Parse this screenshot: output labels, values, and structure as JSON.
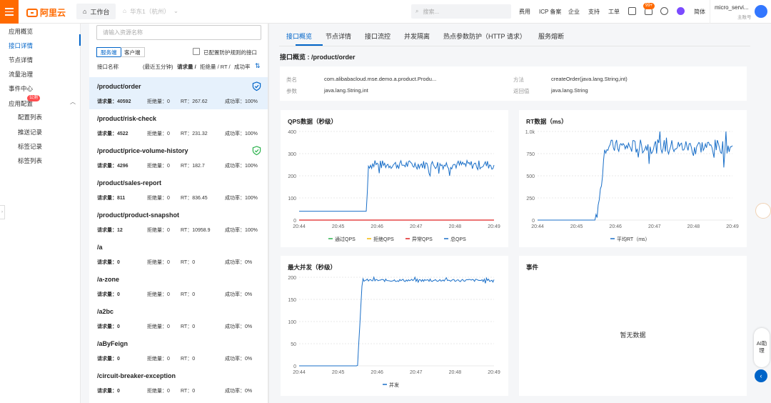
{
  "topbar": {
    "brand": "阿里云",
    "workbench": "工作台",
    "region": "华东1（杭州）",
    "search_placeholder": "搜索...",
    "nav": [
      "费用",
      "ICP 备案",
      "企业",
      "支持",
      "工单"
    ],
    "badge": "99+",
    "lang": "简体",
    "user": "micro_servi...",
    "user_sub": "主账号"
  },
  "sidebar": {
    "items": [
      "应用概览",
      "接口详情",
      "节点详情",
      "流量治理",
      "事件中心",
      "应用配置",
      "配置列表",
      "推送记录",
      "标签记录",
      "标签列表"
    ],
    "hot": "公测"
  },
  "list": {
    "search_placeholder": "请输入资源名称",
    "seg": [
      "服务端",
      "客户端"
    ],
    "checkbox_label": "已配置防护规则的接口",
    "headers": [
      "接口名称",
      "(最近五分钟)",
      "请求量 /",
      "拒绝量 / RT /",
      "成功率"
    ],
    "stat_labels": {
      "req": "请求量：",
      "rej": "拒绝量：",
      "rt": "RT：",
      "succ": "成功率："
    },
    "rows": [
      {
        "name": "/product/order",
        "req": "40592",
        "rej": "0",
        "rt": "267.62",
        "succ": "100%"
      },
      {
        "name": "/product/risk-check",
        "req": "4522",
        "rej": "0",
        "rt": "231.32",
        "succ": "100%"
      },
      {
        "name": "/product/price-volume-history",
        "req": "4296",
        "rej": "0",
        "rt": "182.7",
        "succ": "100%"
      },
      {
        "name": "/product/sales-report",
        "req": "811",
        "rej": "0",
        "rt": "836.45",
        "succ": "100%"
      },
      {
        "name": "/product/product-snapshot",
        "req": "12",
        "rej": "0",
        "rt": "10958.9",
        "succ": "100%"
      },
      {
        "name": "/a",
        "req": "0",
        "rej": "0",
        "rt": "0",
        "succ": "0%"
      },
      {
        "name": "/a-zone",
        "req": "0",
        "rej": "0",
        "rt": "0",
        "succ": "0%"
      },
      {
        "name": "/a2bc",
        "req": "0",
        "rej": "0",
        "rt": "0",
        "succ": "0%"
      },
      {
        "name": "/aByFeign",
        "req": "0",
        "rej": "0",
        "rt": "0",
        "succ": "0%"
      },
      {
        "name": "/circuit-breaker-exception",
        "req": "0",
        "rej": "0",
        "rt": "0",
        "succ": "0%"
      }
    ]
  },
  "tabs": [
    "接口概览",
    "节点详情",
    "接口流控",
    "并发隔离",
    "热点参数防护（HTTP 请求）",
    "服务熔断"
  ],
  "overview": {
    "title": "接口概览 : /product/order",
    "info": {
      "class_label": "类名",
      "class": "com.alibabacloud.mse.demo.a.product.Produ...",
      "method_label": "方法",
      "method": "createOrder(java.lang.String,int)",
      "params_label": "参数",
      "params": "java.lang.String,int",
      "return_label": "返回值",
      "return": "java.lang.String"
    }
  },
  "events": {
    "title": "事件",
    "empty": "暂无数据"
  },
  "assistant": {
    "label": "AI助理"
  },
  "colors": {
    "accent": "#0064c8",
    "brand": "#ff6a00",
    "series_blue": "#1a6fc8",
    "series_red": "#e02020",
    "series_green": "#2bb24c",
    "series_yellow": "#f5b800"
  },
  "chart_data": [
    {
      "type": "line",
      "title": "QPS数据（秒级）",
      "x_ticks": [
        "20:44",
        "20:45",
        "20:46",
        "20:47",
        "20:48",
        "20:49"
      ],
      "ylim": [
        0,
        400
      ],
      "y_ticks": [
        0,
        100,
        200,
        300,
        400
      ],
      "series": [
        {
          "name": "通过QPS",
          "color": "#2bb24c"
        },
        {
          "name": "拒绝QPS",
          "color": "#f5b800"
        },
        {
          "name": "异常QPS",
          "color": "#e02020"
        },
        {
          "name": "总QPS",
          "color": "#1a6fc8"
        }
      ],
      "approx_values": {
        "before_20:45:45": 40,
        "after_20:45:45": 250,
        "red_line": 0
      }
    },
    {
      "type": "line",
      "title": "RT数据（ms）",
      "x_ticks": [
        "20:44",
        "20:45",
        "20:46",
        "20:47",
        "20:48",
        "20:49"
      ],
      "ylim": [
        0,
        1000
      ],
      "y_ticks": [
        "0",
        "250",
        "500",
        "750",
        "1.0k"
      ],
      "series": [
        {
          "name": "平均RT（ms）",
          "color": "#1a6fc8"
        }
      ],
      "approx_values": {
        "before_20:45:30": 0,
        "after_20:46": 820
      }
    },
    {
      "type": "line",
      "title": "最大并发（秒级）",
      "x_ticks": [
        "20:44",
        "20:45",
        "20:46",
        "20:47",
        "20:48",
        "20:49"
      ],
      "ylim": [
        0,
        200
      ],
      "y_ticks": [
        0,
        50,
        100,
        150,
        200
      ],
      "series": [
        {
          "name": "并发",
          "color": "#1a6fc8"
        }
      ],
      "approx_values": {
        "before_20:45:30": 0,
        "after_20:45:40": 195
      }
    }
  ]
}
